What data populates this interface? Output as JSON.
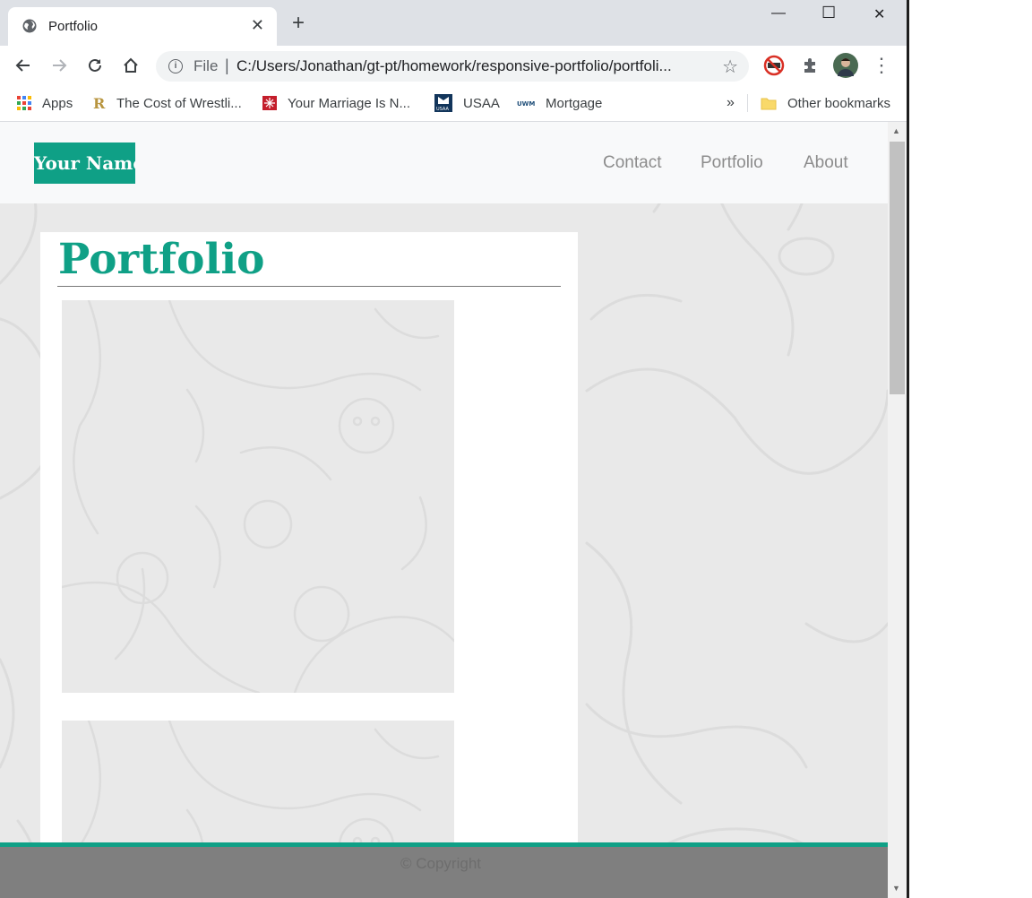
{
  "tab": {
    "title": "Portfolio"
  },
  "window": {
    "minimize": "—",
    "maximize": "☐",
    "close": "✕"
  },
  "address_bar": {
    "scheme": "File",
    "url": "C:/Users/Jonathan/gt-pt/homework/responsive-portfolio/portfoli..."
  },
  "bookmarks": {
    "items": [
      {
        "label": "Apps",
        "icon": "apps-grid-icon"
      },
      {
        "label": "The Cost of Wrestli...",
        "icon": "bookmark-r-icon"
      },
      {
        "label": "Your Marriage Is N...",
        "icon": "bookmark-red-icon"
      },
      {
        "label": "USAA",
        "icon": "usaa-icon"
      },
      {
        "label": "Mortgage",
        "icon": "uwm-icon"
      }
    ],
    "overflow": "»",
    "other": "Other bookmarks"
  },
  "site": {
    "brand": "Your Name",
    "nav": [
      "Contact",
      "Portfolio",
      "About"
    ],
    "heading": "Portfolio",
    "footer": "© Copyright"
  },
  "colors": {
    "accent": "#0fa086",
    "footer_bg": "#7f7f7f",
    "nav_bg": "#f8f9fa",
    "nav_link": "#8c8c8c"
  }
}
